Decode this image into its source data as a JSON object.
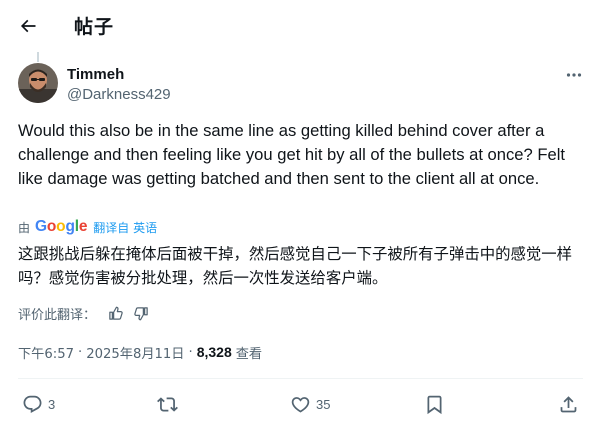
{
  "header": {
    "title": "帖子"
  },
  "author": {
    "name": "Timmeh",
    "handle": "@Darkness429"
  },
  "tweet": {
    "text": "Would this also be in the same line as getting killed behind cover after a challenge and then feeling like you get hit by all of the bullets at once? Felt like damage was getting batched and then sent to the client all at once."
  },
  "translation": {
    "by_prefix": "由",
    "provider_letters": [
      "G",
      "o",
      "o",
      "g",
      "l",
      "e"
    ],
    "link_label": "翻译自 英语",
    "text": "这跟挑战后躲在掩体后面被干掉，然后感觉自己一下子被所有子弹击中的感觉一样吗？感觉伤害被分批处理，然后一次性发送给客户端。",
    "rate_label": "评价此翻译："
  },
  "meta": {
    "time": "下午6:57",
    "date": "2025年8月11日",
    "separator": "·",
    "views": "8,328",
    "views_label": "查看"
  },
  "actions": {
    "reply_count": "3",
    "repost_count": "",
    "like_count": "35"
  },
  "icons": {
    "back": "arrow-left-icon",
    "more": "more-horizontal-icon",
    "thumbs_up": "thumbs-up-icon",
    "thumbs_down": "thumbs-down-icon",
    "reply": "reply-icon",
    "repost": "repost-icon",
    "like": "heart-icon",
    "bookmark": "bookmark-icon",
    "share": "share-icon"
  },
  "colors": {
    "text_primary": "#0f1419",
    "text_secondary": "#536471",
    "accent": "#1d9bf0",
    "divider": "#eff3f4"
  }
}
